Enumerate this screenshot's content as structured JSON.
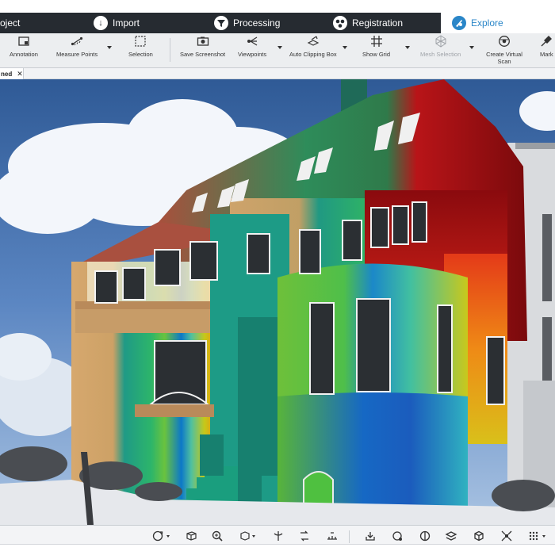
{
  "stage_tabs": [
    {
      "label": "oject",
      "icon": "project-icon"
    },
    {
      "label": "Import",
      "icon": "import-icon"
    },
    {
      "label": "Processing",
      "icon": "processing-icon"
    },
    {
      "label": "Registration",
      "icon": "registration-icon"
    },
    {
      "label": "Explore",
      "icon": "explore-icon",
      "active": true
    }
  ],
  "ribbon": {
    "annotation": "Annotation",
    "measure_points": "Measure Points",
    "selection": "Selection",
    "save_screenshot": "Save Screenshot",
    "viewpoints": "Viewpoints",
    "auto_clipping_box": "Auto Clipping Box",
    "show_grid": "Show Grid",
    "mesh_selection": "Mesh Selection",
    "create_virtual_scan": "Create Virtual Scan",
    "mark": "Mark"
  },
  "document_tab": {
    "label": "ned"
  },
  "colors": {
    "stage_dark": "#262b31",
    "accent": "#2a86c8",
    "ribbon_bg": "#eceef0"
  }
}
